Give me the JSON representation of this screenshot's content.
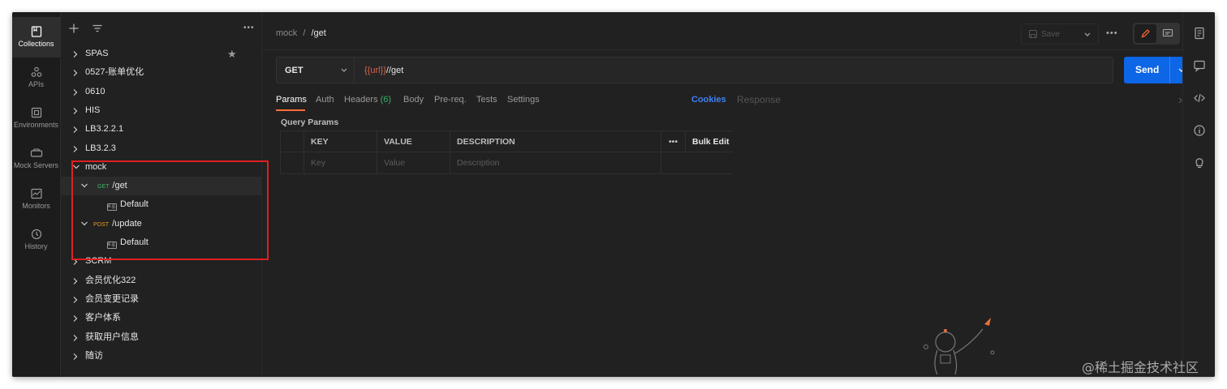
{
  "rail": [
    {
      "label": "Collections",
      "icon": "collections-icon",
      "active": true
    },
    {
      "label": "APIs",
      "icon": "apis-icon",
      "active": false
    },
    {
      "label": "Environments",
      "icon": "environments-icon",
      "active": false
    },
    {
      "label": "Mock Servers",
      "icon": "mock-servers-icon",
      "active": false
    },
    {
      "label": "Monitors",
      "icon": "monitors-icon",
      "active": false
    },
    {
      "label": "History",
      "icon": "history-icon",
      "active": false
    }
  ],
  "sidebar": {
    "more": "•••",
    "collections": [
      {
        "label": "SPAS",
        "starred": true
      },
      {
        "label": "0527-账单优化"
      },
      {
        "label": "0610"
      },
      {
        "label": "HIS"
      },
      {
        "label": "LB3.2.2.1"
      },
      {
        "label": "LB3.2.3"
      },
      {
        "label": "mock",
        "expanded": true
      },
      {
        "label": "SCRM"
      },
      {
        "label": "会员优化322"
      },
      {
        "label": "会员变更记录"
      },
      {
        "label": "客户体系"
      },
      {
        "label": "获取用户信息"
      },
      {
        "label": "随访"
      }
    ],
    "mock_children": [
      {
        "method": "GET",
        "method_color": "#3ab36a",
        "path": "/get",
        "example": "Default"
      },
      {
        "method": "POST",
        "method_color": "#e39a29",
        "path": "/update",
        "example": "Default"
      }
    ],
    "example_icon_text": "e.g."
  },
  "breadcrumb": {
    "parent": "mock",
    "separator": "/",
    "current": "/get"
  },
  "toolbar": {
    "save_label": "Save",
    "more": "•••"
  },
  "request": {
    "method": "GET",
    "url_var": "{{url}}",
    "url_rest": "//get",
    "send_label": "Send"
  },
  "tabs": {
    "params": "Params",
    "auth": "Auth",
    "headers": "Headers",
    "headers_count": "(6)",
    "body": "Body",
    "prereq": "Pre-req.",
    "tests": "Tests",
    "settings": "Settings",
    "cookies": "Cookies",
    "response": "Response"
  },
  "params": {
    "title": "Query Params",
    "columns": [
      "KEY",
      "VALUE",
      "DESCRIPTION"
    ],
    "more": "•••",
    "bulk_edit": "Bulk Edit",
    "placeholders": [
      "Key",
      "Value",
      "Description"
    ]
  },
  "colors": {
    "accent": "#ff6c37",
    "send": "#0d66e6",
    "cookies": "#3b82f6",
    "highlight_box": "#e02020"
  },
  "watermark": "@稀土掘金技术社区"
}
